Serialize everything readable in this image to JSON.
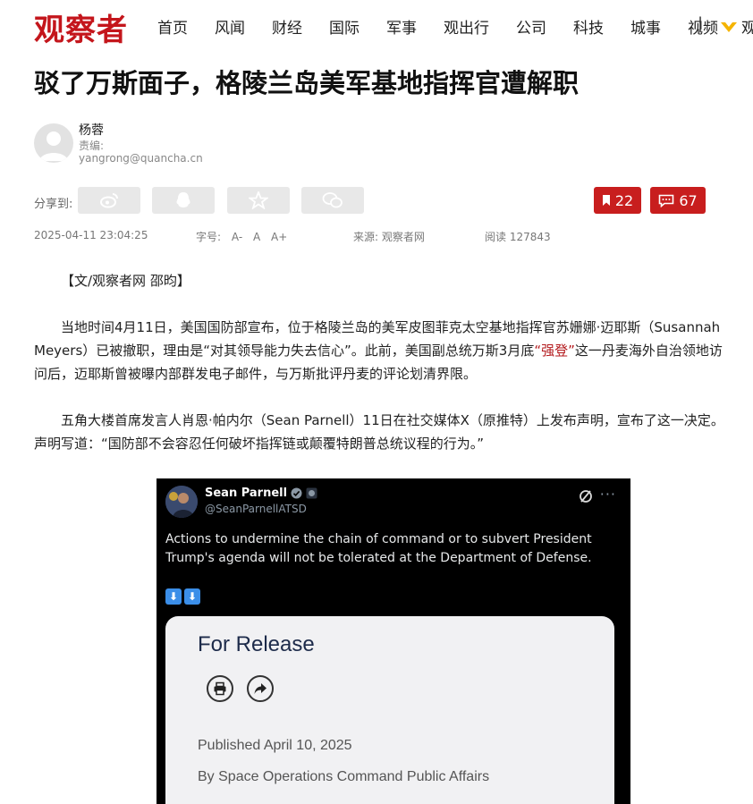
{
  "site": {
    "logo": "观察者"
  },
  "nav": {
    "items": [
      "首页",
      "风闻",
      "财经",
      "国际",
      "军事",
      "观出行",
      "公司",
      "科技",
      "城事",
      "视频"
    ],
    "separator": "|",
    "vip_label": "观"
  },
  "article": {
    "title": "驳了万斯面子，格陵兰岛美军基地指挥官遭解职",
    "author": {
      "name": "杨蓉",
      "role_label": "责编:",
      "email": "yangrong@quancha.cn"
    },
    "share_label": "分享到:",
    "bookmark_count": "22",
    "comment_count": "67",
    "date": "2025-04-11 23:04:25",
    "font_size_label": "字号:",
    "font_sizes": [
      "A-",
      "A",
      "A+"
    ],
    "source_label": "来源: 观察者网",
    "views_label": "阅读 127843",
    "byline": "【文/观察者网 邵昀】",
    "p1_a": "当地时间4月11日，美国国防部宣布，位于格陵兰岛的美军皮图菲克太空基地指挥官苏姗娜·迈耶斯（Susannah Meyers）已被撤职，理由是“对其领导能力失去信心”。此前，美国副总统万斯3月底",
    "p1_link": "“强登”",
    "p1_b": "这一丹麦海外自治领地访问后，迈耶斯曾被曝内部群发电子邮件，与万斯批评丹麦的评论划清界限。",
    "p2": "五角大楼首席发言人肖恩·帕内尔（Sean Parnell）11日在社交媒体X（原推特）上发布声明，宣布了这一决定。声明写道：“国防部不会容忍任何破坏指挥链或颠覆特朗普总统议程的行为。”"
  },
  "tweet": {
    "name": "Sean Parnell",
    "handle": "@SeanParnellATSD",
    "more": "···",
    "text": "Actions to undermine the chain of command or to subvert President Trump's agenda will not be tolerated at the Department of Defense.",
    "emoji": [
      "⬇",
      "⬇"
    ],
    "card": {
      "title": "For Release",
      "published": "Published April 10, 2025",
      "by": "By Space Operations Command Public Affairs"
    }
  },
  "colors": {
    "brand_red": "#c4161c",
    "badge_red": "#c81e1e",
    "link_red": "#b3191c",
    "tweet_bg": "#000000"
  },
  "icons": [
    "weibo-icon",
    "qq-icon",
    "qzone-icon",
    "wechat-icon",
    "bookmark-icon",
    "comment-icon",
    "verified-icon",
    "grok-icon",
    "print-icon",
    "share-icon",
    "vip-icon"
  ]
}
